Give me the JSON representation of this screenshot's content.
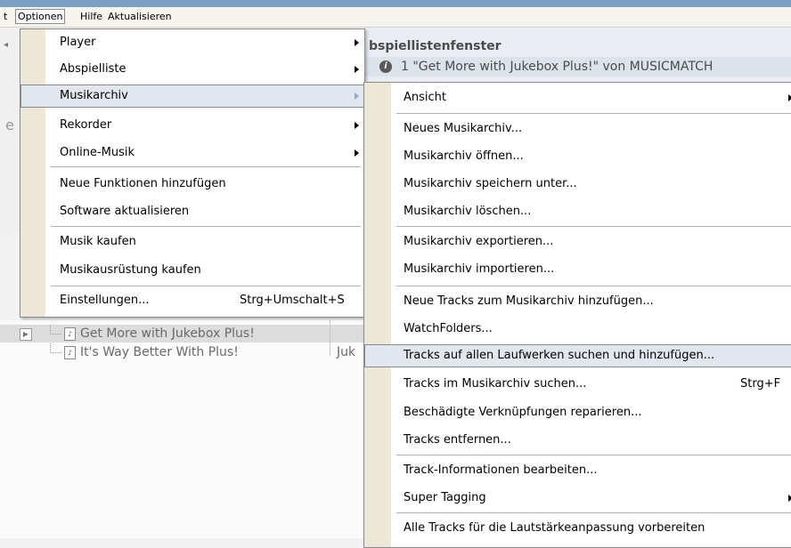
{
  "menubar": {
    "items": [
      {
        "label": "t"
      },
      {
        "label": "Optionen"
      },
      {
        "label": "Hilfe"
      },
      {
        "label": "Aktualisieren"
      }
    ]
  },
  "background": {
    "left_label": "e",
    "playlist_title": "bspiellistenfenster",
    "now_playing_icon": "info-icon",
    "now_playing_text": "1  \"Get More with Jukebox Plus!\" von MUSICMATCH",
    "tree": [
      {
        "label": "Get More with Jukebox Plus!",
        "extra": ""
      },
      {
        "label": "It's Way Better With Plus!",
        "extra": "Juk"
      }
    ]
  },
  "options_menu": {
    "items": [
      {
        "label": "Player",
        "shortcut": "",
        "submenu": true
      },
      {
        "label": "Abspielliste",
        "shortcut": "",
        "submenu": true
      },
      {
        "label": "Musikarchiv",
        "shortcut": "",
        "submenu": true
      },
      {
        "label": "Rekorder",
        "shortcut": "",
        "submenu": true
      },
      {
        "label": "Online-Musik",
        "shortcut": "",
        "submenu": true
      },
      {
        "label": "Neue Funktionen hinzufügen",
        "shortcut": "",
        "submenu": false
      },
      {
        "label": "Software aktualisieren",
        "shortcut": "",
        "submenu": false
      },
      {
        "label": "Musik kaufen",
        "shortcut": "",
        "submenu": false
      },
      {
        "label": "Musikausrüstung kaufen",
        "shortcut": "",
        "submenu": false
      },
      {
        "label": "Einstellungen...",
        "shortcut": "Strg+Umschalt+S",
        "submenu": false
      }
    ]
  },
  "archive_menu": {
    "items": [
      {
        "label": "Ansicht",
        "shortcut": "",
        "submenu": true
      },
      {
        "label": "Neues Musikarchiv...",
        "shortcut": "",
        "submenu": false
      },
      {
        "label": "Musikarchiv öffnen...",
        "shortcut": "",
        "submenu": false
      },
      {
        "label": "Musikarchiv speichern unter...",
        "shortcut": "",
        "submenu": false
      },
      {
        "label": "Musikarchiv löschen...",
        "shortcut": "",
        "submenu": false
      },
      {
        "label": "Musikarchiv exportieren...",
        "shortcut": "",
        "submenu": false
      },
      {
        "label": "Musikarchiv importieren...",
        "shortcut": "",
        "submenu": false
      },
      {
        "label": "Neue Tracks zum Musikarchiv hinzufügen...",
        "shortcut": "",
        "submenu": false
      },
      {
        "label": "WatchFolders...",
        "shortcut": "",
        "submenu": false
      },
      {
        "label": "Tracks auf allen Laufwerken suchen und hinzufügen...",
        "shortcut": "",
        "submenu": false
      },
      {
        "label": "Tracks im Musikarchiv suchen...",
        "shortcut": "Strg+F",
        "submenu": false
      },
      {
        "label": "Beschädigte Verknüpfungen reparieren...",
        "shortcut": "",
        "submenu": false
      },
      {
        "label": "Tracks entfernen...",
        "shortcut": "",
        "submenu": false
      },
      {
        "label": "Track-Informationen bearbeiten...",
        "shortcut": "",
        "submenu": false
      },
      {
        "label": "Super Tagging",
        "shortcut": "",
        "submenu": true
      },
      {
        "label": "Alle Tracks für die Lautstärkeanpassung vorbereiten",
        "shortcut": "",
        "submenu": false
      }
    ]
  }
}
